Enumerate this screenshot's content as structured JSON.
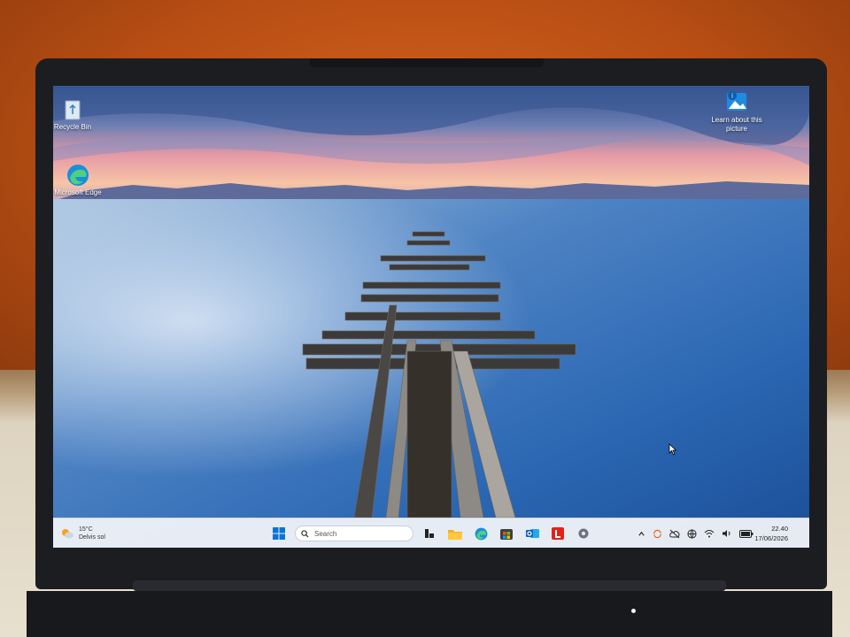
{
  "desktop": {
    "icons": [
      {
        "label": "Recycle Bin",
        "icon": "recycle-bin-icon"
      },
      {
        "label": "Microsoft Edge",
        "icon": "edge-icon"
      },
      {
        "label": "Learn about this picture",
        "icon": "learn-picture-icon"
      }
    ]
  },
  "taskbar": {
    "weather": {
      "temp": "15°C",
      "condition": "Delvis sol"
    },
    "search_placeholder": "Search",
    "apps": [
      "start-icon",
      "search-icon",
      "task-view-icon",
      "file-explorer-icon",
      "edge-icon",
      "store-icon",
      "outlook-icon",
      "lenovo-icon",
      "settings-icon"
    ],
    "tray": [
      "chevron-up-icon",
      "sync-icon",
      "cloud-off-icon",
      "language-icon",
      "wifi-icon",
      "volume-icon",
      "battery-icon"
    ],
    "clock": {
      "time": "22.40",
      "date": "17/06/2026"
    }
  },
  "colors": {
    "accent": "#0078d4",
    "taskbar": "#eef1f7"
  }
}
